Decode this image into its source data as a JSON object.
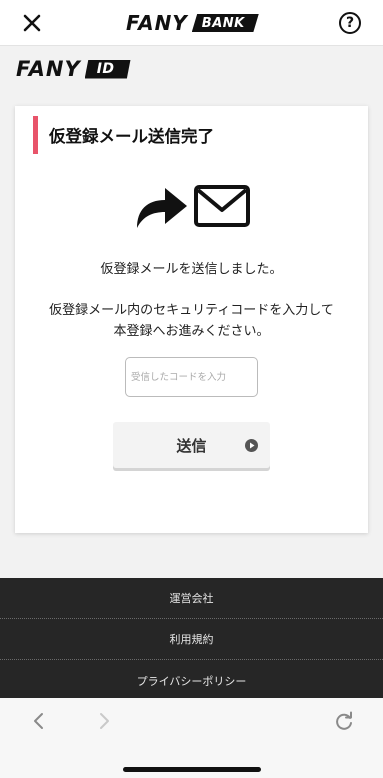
{
  "header": {
    "brand_word": "FANY",
    "brand_tag": "BANK",
    "help_label": "?"
  },
  "id_bar": {
    "brand_word": "FANY",
    "brand_tag": "ID"
  },
  "card": {
    "title": "仮登録メール送信完了",
    "message1": "仮登録メールを送信しました。",
    "message2_line1": "仮登録メール内のセキュリティコードを入力して",
    "message2_line2": "本登録へお進みください。",
    "code_input": {
      "placeholder": "受信したコードを入力",
      "value": ""
    },
    "submit_label": "送信"
  },
  "footer": {
    "links": [
      {
        "label": "運営会社"
      },
      {
        "label": "利用規約"
      },
      {
        "label": "プライバシーポリシー"
      }
    ]
  },
  "colors": {
    "accent": "#e8546a",
    "footer_bg": "#262626",
    "page_bg": "#f2f2f2"
  },
  "icons": [
    "close-icon",
    "help-icon",
    "arrow-forward-icon",
    "envelope-icon",
    "play-circle-icon",
    "chevron-left-icon",
    "chevron-right-icon",
    "reload-icon"
  ]
}
